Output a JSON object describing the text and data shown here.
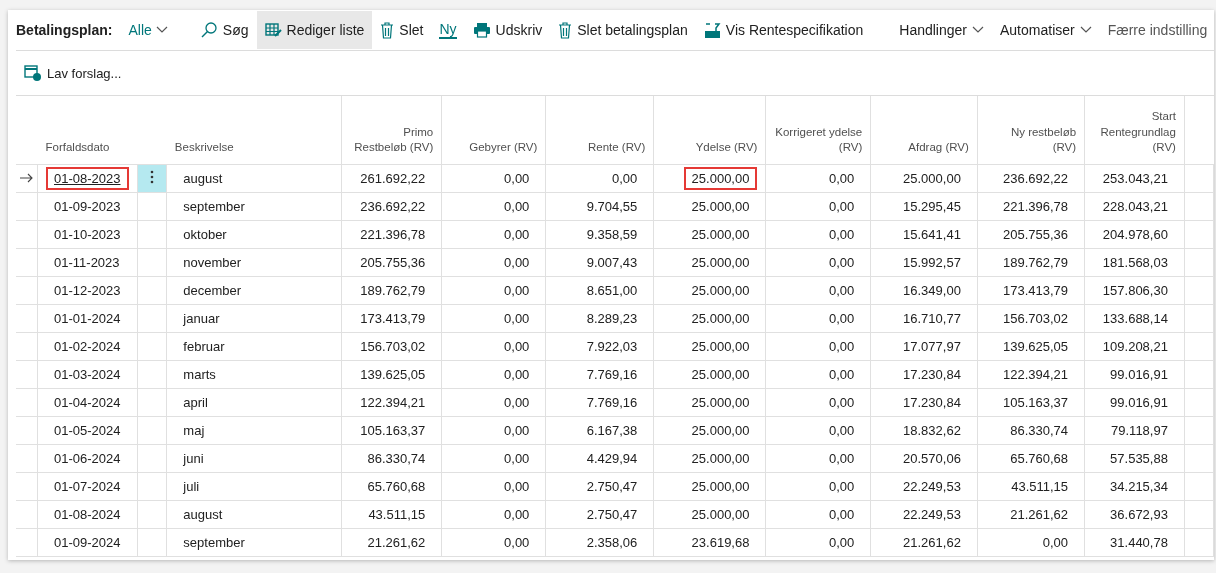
{
  "toolbar": {
    "label": "Betalingsplan:",
    "filter": "Alle",
    "actions": [
      {
        "kind": "search",
        "label": "Søg",
        "selected": false
      },
      {
        "kind": "edit",
        "label": "Rediger liste",
        "selected": true
      },
      {
        "kind": "trash",
        "label": "Slet",
        "selected": false
      },
      {
        "kind": "plain",
        "label": "Ny",
        "selected": false
      },
      {
        "kind": "print",
        "label": "Udskriv",
        "selected": false
      },
      {
        "kind": "trash",
        "label": "Slet betalingsplan",
        "selected": false
      },
      {
        "kind": "spec",
        "label": "Vis Rentespecifikation",
        "selected": false
      }
    ],
    "menus": [
      {
        "label": "Handlinger",
        "kind": "dropdown"
      },
      {
        "label": "Automatiser",
        "kind": "dropdown"
      },
      {
        "label": "Færre indstilling",
        "kind": "plain"
      }
    ]
  },
  "secondary_action": "Lav forslag...",
  "table": {
    "columns": [
      {
        "label": "Forfaldsdato"
      },
      {
        "label": "Beskrivelse"
      },
      {
        "label": "Primo Restbeløb (RV)"
      },
      {
        "label": "Gebyrer (RV)"
      },
      {
        "label": "Rente (RV)"
      },
      {
        "label": "Ydelse (RV)"
      },
      {
        "label": "Korrigeret ydelse (RV)"
      },
      {
        "label": "Afdrag (RV)"
      },
      {
        "label": "Ny restbeløb (RV)"
      },
      {
        "label": "Start Rentegrundlag (RV)"
      }
    ],
    "rows": [
      {
        "selected": true,
        "marked": [
          true,
          false,
          false,
          false,
          false,
          true,
          false,
          false,
          false,
          false
        ],
        "cells": [
          "01-08-2023",
          "august",
          "261.692,22",
          "0,00",
          "0,00",
          "25.000,00",
          "0,00",
          "25.000,00",
          "236.692,22",
          "253.043,21"
        ]
      },
      {
        "selected": false,
        "marked": [
          false,
          false,
          false,
          false,
          false,
          false,
          false,
          false,
          false,
          false
        ],
        "cells": [
          "01-09-2023",
          "september",
          "236.692,22",
          "0,00",
          "9.704,55",
          "25.000,00",
          "0,00",
          "15.295,45",
          "221.396,78",
          "228.043,21"
        ]
      },
      {
        "selected": false,
        "marked": [
          false,
          false,
          false,
          false,
          false,
          false,
          false,
          false,
          false,
          false
        ],
        "cells": [
          "01-10-2023",
          "oktober",
          "221.396,78",
          "0,00",
          "9.358,59",
          "25.000,00",
          "0,00",
          "15.641,41",
          "205.755,36",
          "204.978,60"
        ]
      },
      {
        "selected": false,
        "marked": [
          false,
          false,
          false,
          false,
          false,
          false,
          false,
          false,
          false,
          false
        ],
        "cells": [
          "01-11-2023",
          "november",
          "205.755,36",
          "0,00",
          "9.007,43",
          "25.000,00",
          "0,00",
          "15.992,57",
          "189.762,79",
          "181.568,03"
        ]
      },
      {
        "selected": false,
        "marked": [
          false,
          false,
          false,
          false,
          false,
          false,
          false,
          false,
          false,
          false
        ],
        "cells": [
          "01-12-2023",
          "december",
          "189.762,79",
          "0,00",
          "8.651,00",
          "25.000,00",
          "0,00",
          "16.349,00",
          "173.413,79",
          "157.806,30"
        ]
      },
      {
        "selected": false,
        "marked": [
          false,
          false,
          false,
          false,
          false,
          false,
          false,
          false,
          false,
          false
        ],
        "cells": [
          "01-01-2024",
          "januar",
          "173.413,79",
          "0,00",
          "8.289,23",
          "25.000,00",
          "0,00",
          "16.710,77",
          "156.703,02",
          "133.688,14"
        ]
      },
      {
        "selected": false,
        "marked": [
          false,
          false,
          false,
          false,
          false,
          false,
          false,
          false,
          false,
          false
        ],
        "cells": [
          "01-02-2024",
          "februar",
          "156.703,02",
          "0,00",
          "7.922,03",
          "25.000,00",
          "0,00",
          "17.077,97",
          "139.625,05",
          "109.208,21"
        ]
      },
      {
        "selected": false,
        "marked": [
          false,
          false,
          false,
          false,
          false,
          false,
          false,
          false,
          false,
          false
        ],
        "cells": [
          "01-03-2024",
          "marts",
          "139.625,05",
          "0,00",
          "7.769,16",
          "25.000,00",
          "0,00",
          "17.230,84",
          "122.394,21",
          "99.016,91"
        ]
      },
      {
        "selected": false,
        "marked": [
          false,
          false,
          false,
          false,
          false,
          false,
          false,
          false,
          false,
          false
        ],
        "cells": [
          "01-04-2024",
          "april",
          "122.394,21",
          "0,00",
          "7.769,16",
          "25.000,00",
          "0,00",
          "17.230,84",
          "105.163,37",
          "99.016,91"
        ]
      },
      {
        "selected": false,
        "marked": [
          false,
          false,
          false,
          false,
          false,
          false,
          false,
          false,
          false,
          false
        ],
        "cells": [
          "01-05-2024",
          "maj",
          "105.163,37",
          "0,00",
          "6.167,38",
          "25.000,00",
          "0,00",
          "18.832,62",
          "86.330,74",
          "79.118,97"
        ]
      },
      {
        "selected": false,
        "marked": [
          false,
          false,
          false,
          false,
          false,
          false,
          false,
          false,
          false,
          false
        ],
        "cells": [
          "01-06-2024",
          "juni",
          "86.330,74",
          "0,00",
          "4.429,94",
          "25.000,00",
          "0,00",
          "20.570,06",
          "65.760,68",
          "57.535,88"
        ]
      },
      {
        "selected": false,
        "marked": [
          false,
          false,
          false,
          false,
          false,
          false,
          false,
          false,
          false,
          false
        ],
        "cells": [
          "01-07-2024",
          "juli",
          "65.760,68",
          "0,00",
          "2.750,47",
          "25.000,00",
          "0,00",
          "22.249,53",
          "43.511,15",
          "34.215,34"
        ]
      },
      {
        "selected": false,
        "marked": [
          false,
          false,
          false,
          false,
          false,
          false,
          false,
          false,
          false,
          false
        ],
        "cells": [
          "01-08-2024",
          "august",
          "43.511,15",
          "0,00",
          "2.750,47",
          "25.000,00",
          "0,00",
          "22.249,53",
          "21.261,62",
          "36.672,93"
        ]
      },
      {
        "selected": false,
        "marked": [
          false,
          false,
          false,
          false,
          false,
          false,
          false,
          false,
          false,
          false
        ],
        "cells": [
          "01-09-2024",
          "september",
          "21.261,62",
          "0,00",
          "2.358,06",
          "23.619,68",
          "0,00",
          "21.261,62",
          "0,00",
          "31.440,78"
        ]
      }
    ]
  }
}
